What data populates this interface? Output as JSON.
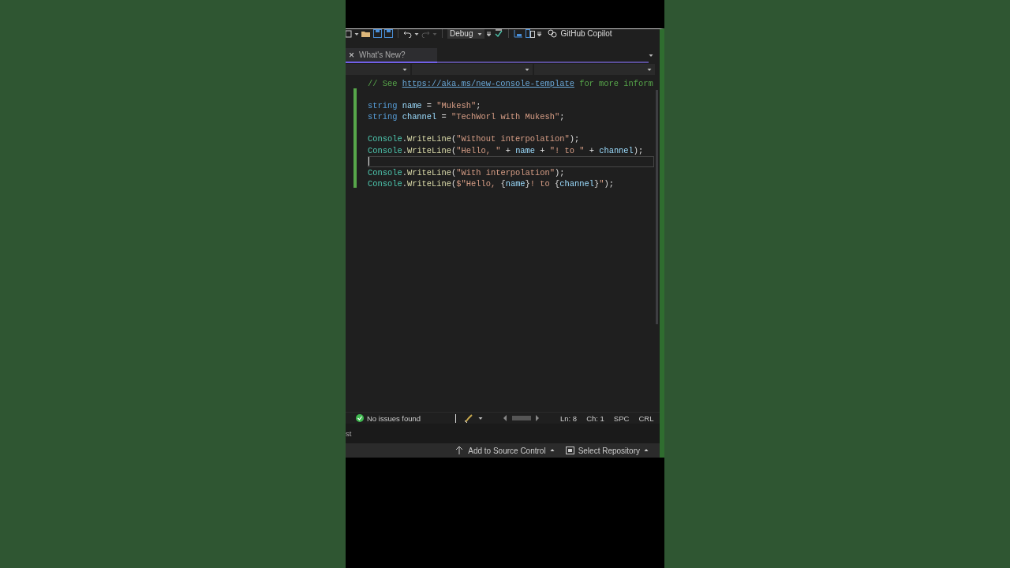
{
  "toolbar": {
    "configuration": "Debug",
    "copilot": "GitHub Copilot"
  },
  "tabs": [
    {
      "label": "What's New?",
      "close": "×",
      "selected": true
    }
  ],
  "editor": {
    "lines": [
      {
        "kind": "code",
        "tokens": [
          {
            "text": "// See ",
            "kind": "comment"
          },
          {
            "text": "https://aka.ms/new-console-template",
            "kind": "link"
          },
          {
            "text": " for more inform",
            "kind": "comment"
          }
        ]
      },
      {
        "kind": "blank"
      },
      {
        "kind": "code",
        "tokens": [
          {
            "text": "string ",
            "kind": "keyword"
          },
          {
            "text": "name",
            "kind": "ident"
          },
          {
            "text": " = ",
            "kind": "plain"
          },
          {
            "text": "\"Mukesh\"",
            "kind": "string"
          },
          {
            "text": ";",
            "kind": "plain"
          }
        ]
      },
      {
        "kind": "code",
        "tokens": [
          {
            "text": "string ",
            "kind": "keyword"
          },
          {
            "text": "channel",
            "kind": "ident"
          },
          {
            "text": " = ",
            "kind": "plain"
          },
          {
            "text": "\"TechWorl with Mukesh\"",
            "kind": "string"
          },
          {
            "text": ";",
            "kind": "plain"
          }
        ]
      },
      {
        "kind": "blank"
      },
      {
        "kind": "code",
        "tokens": [
          {
            "text": "Console",
            "kind": "type"
          },
          {
            "text": ".",
            "kind": "plain"
          },
          {
            "text": "WriteLine",
            "kind": "method"
          },
          {
            "text": "(",
            "kind": "plain"
          },
          {
            "text": "\"Without interpolation\"",
            "kind": "string"
          },
          {
            "text": ");",
            "kind": "plain"
          }
        ]
      },
      {
        "kind": "code",
        "tokens": [
          {
            "text": "Console",
            "kind": "type"
          },
          {
            "text": ".",
            "kind": "plain"
          },
          {
            "text": "WriteLine",
            "kind": "method"
          },
          {
            "text": "(",
            "kind": "plain"
          },
          {
            "text": "\"Hello, \"",
            "kind": "string"
          },
          {
            "text": " + ",
            "kind": "plain"
          },
          {
            "text": "name",
            "kind": "ident"
          },
          {
            "text": " + ",
            "kind": "plain"
          },
          {
            "text": "\"! to \"",
            "kind": "string"
          },
          {
            "text": " + ",
            "kind": "plain"
          },
          {
            "text": "channel",
            "kind": "ident"
          },
          {
            "text": ");",
            "kind": "plain"
          }
        ]
      },
      {
        "kind": "current"
      },
      {
        "kind": "code",
        "tokens": [
          {
            "text": "Console",
            "kind": "type"
          },
          {
            "text": ".",
            "kind": "plain"
          },
          {
            "text": "WriteLine",
            "kind": "method"
          },
          {
            "text": "(",
            "kind": "plain"
          },
          {
            "text": "\"With interpolation\"",
            "kind": "string"
          },
          {
            "text": ");",
            "kind": "plain"
          }
        ]
      },
      {
        "kind": "code",
        "tokens": [
          {
            "text": "Console",
            "kind": "type"
          },
          {
            "text": ".",
            "kind": "plain"
          },
          {
            "text": "WriteLine",
            "kind": "method"
          },
          {
            "text": "(",
            "kind": "plain"
          },
          {
            "text": "$\"Hello, ",
            "kind": "string"
          },
          {
            "text": "{",
            "kind": "plain"
          },
          {
            "text": "name",
            "kind": "ident"
          },
          {
            "text": "}",
            "kind": "plain"
          },
          {
            "text": "! to ",
            "kind": "string"
          },
          {
            "text": "{",
            "kind": "plain"
          },
          {
            "text": "channel",
            "kind": "ident"
          },
          {
            "text": "}",
            "kind": "plain"
          },
          {
            "text": "\"",
            "kind": "string"
          },
          {
            "text": ");",
            "kind": "plain"
          }
        ]
      }
    ]
  },
  "status_bar": {
    "issues": "No issues found",
    "items": [
      "Ln: 8",
      "Ch: 1",
      "SPC",
      "CRL"
    ]
  },
  "output": {
    "text": "st"
  },
  "source_bar": {
    "items": [
      "Add to Source Control",
      "Select Repository"
    ]
  }
}
